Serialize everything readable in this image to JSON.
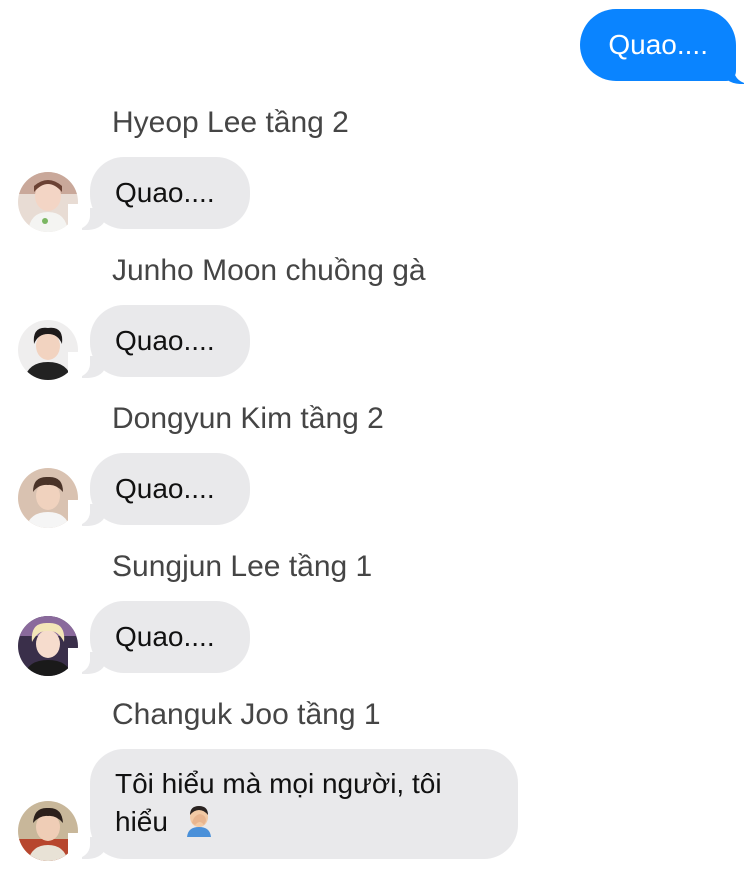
{
  "outgoing": {
    "text": "Quao...."
  },
  "messages": [
    {
      "sender": "Hyeop Lee tầng 2",
      "text": "Quao....",
      "avatar": "avatar-photo-1"
    },
    {
      "sender": "Junho Moon chuồng gà",
      "text": "Quao....",
      "avatar": "avatar-photo-2"
    },
    {
      "sender": "Dongyun Kim tầng 2",
      "text": "Quao....",
      "avatar": "avatar-photo-3"
    },
    {
      "sender": "Sungjun Lee tầng 1",
      "text": "Quao....",
      "avatar": "avatar-photo-4"
    },
    {
      "sender": "Changuk Joo tầng 1",
      "text_line1": "Tôi hiểu mà mọi người, tôi",
      "text_line2": "hiểu",
      "emoji": "man-facepalming-emoji",
      "avatar": "avatar-photo-5"
    }
  ],
  "colors": {
    "outgoing_bubble": "#0a84ff",
    "incoming_bubble": "#e9e9eb",
    "sender_name": "#454545"
  }
}
